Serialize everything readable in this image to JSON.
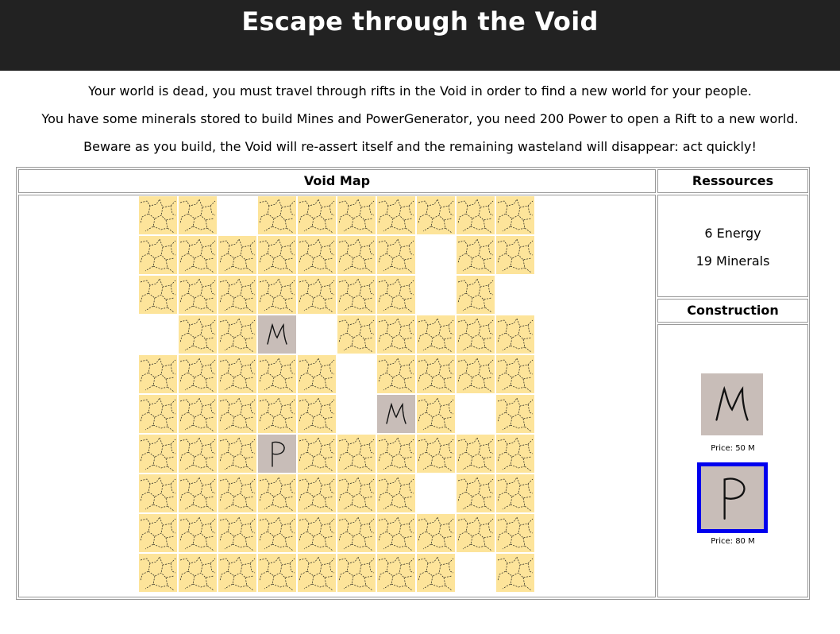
{
  "header": {
    "title": "Escape through the Void"
  },
  "intro": {
    "lines": [
      "Your world is dead, you must travel through rifts in the Void in order to find a new world for your people.",
      "You have some minerals stored to build Mines and PowerGenerator, you need 200 Power to open a Rift to a new world.",
      "Beware as you build, the Void will re-assert itself and the remaining wasteland will disappear: act quickly!"
    ]
  },
  "map": {
    "title": "Void Map",
    "rows": [
      "LL.LLLLLLL",
      "LLLLLLL.LL",
      "LLLLLLL.L.",
      ".LLM.LLLLL",
      "LLLLL.LLLL",
      "LLLLL.ML.L",
      "LLLPLLLLLL",
      "LLLLLLL.LL",
      "LLLLLLLLLL",
      "LLLLLLLL.L"
    ],
    "legend": {
      "L": "wasteland",
      ".": "void",
      "M": "mine",
      "P": "power-generator"
    },
    "colors": {
      "land": "#fde49a",
      "building": "#c8bdb8",
      "crack": "#1a1a1a"
    }
  },
  "resources": {
    "title": "Ressources",
    "energy": "6 Energy",
    "minerals": "19 Minerals"
  },
  "construction": {
    "title": "Construction",
    "items": [
      {
        "id": "mine",
        "glyph": "M",
        "price": "Price: 50 M",
        "selected": false
      },
      {
        "id": "power",
        "glyph": "P",
        "price": "Price: 80 M",
        "selected": true
      }
    ],
    "selection_color": "#0000ee"
  }
}
